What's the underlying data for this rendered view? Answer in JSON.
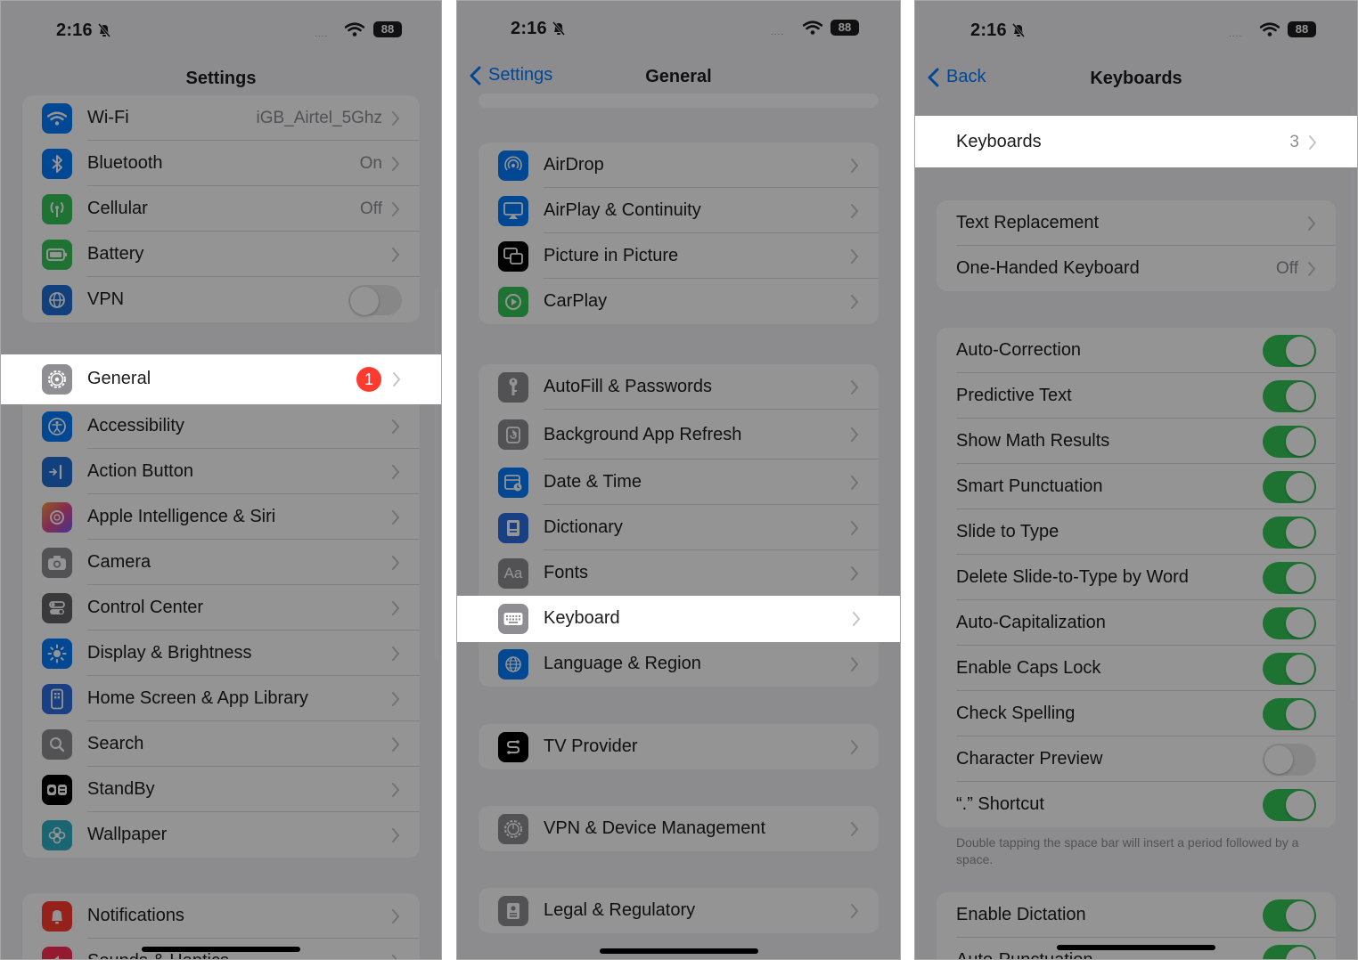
{
  "status": {
    "time": "2:16",
    "battery": "88",
    "signal": "...."
  },
  "panel1": {
    "title": "Settings",
    "group_top": [
      {
        "label": "Wi-Fi",
        "value": "iGB_Airtel_5Ghz",
        "icon": "wifi-icon",
        "color": "#007aff"
      },
      {
        "label": "Bluetooth",
        "value": "On",
        "icon": "bluetooth-icon",
        "color": "#007aff"
      },
      {
        "label": "Cellular",
        "value": "Off",
        "icon": "cellular-icon",
        "color": "#34c759"
      },
      {
        "label": "Battery",
        "value": "",
        "icon": "battery-icon",
        "color": "#34c759"
      },
      {
        "label": "VPN",
        "value": "",
        "icon": "vpn-icon",
        "color": "#1f6fd6"
      }
    ],
    "general": {
      "label": "General",
      "badge": "1",
      "icon": "gear-icon",
      "color": "#8e8e93"
    },
    "group_main": [
      {
        "label": "Accessibility",
        "icon": "accessibility-icon",
        "color": "#007aff"
      },
      {
        "label": "Action Button",
        "icon": "action-button-icon",
        "color": "#1f6fd6"
      },
      {
        "label": "Apple Intelligence & Siri",
        "icon": "siri-icon",
        "color": "#d06bd4"
      },
      {
        "label": "Camera",
        "icon": "camera-icon",
        "color": "#8e8e93"
      },
      {
        "label": "Control Center",
        "icon": "control-center-icon",
        "color": "#636366"
      },
      {
        "label": "Display & Brightness",
        "icon": "brightness-icon",
        "color": "#007aff"
      },
      {
        "label": "Home Screen & App Library",
        "icon": "home-screen-icon",
        "color": "#2c6fe0"
      },
      {
        "label": "Search",
        "icon": "search-icon",
        "color": "#8e8e93"
      },
      {
        "label": "StandBy",
        "icon": "standby-icon",
        "color": "#000000"
      },
      {
        "label": "Wallpaper",
        "icon": "wallpaper-icon",
        "color": "#30b0c7"
      }
    ],
    "group_bottom": [
      {
        "label": "Notifications",
        "icon": "notifications-icon",
        "color": "#ff3b30"
      },
      {
        "label": "Sounds & Haptics",
        "icon": "sounds-icon",
        "color": "#ff2d55"
      }
    ]
  },
  "panel2": {
    "title": "General",
    "back": "Settings",
    "group1": [
      {
        "label": "AirDrop",
        "icon": "airdrop-icon",
        "color": "#007aff"
      },
      {
        "label": "AirPlay & Continuity",
        "icon": "airplay-icon",
        "color": "#007aff"
      },
      {
        "label": "Picture in Picture",
        "icon": "pip-icon",
        "color": "#000000"
      },
      {
        "label": "CarPlay",
        "icon": "carplay-icon",
        "color": "#34c759"
      }
    ],
    "group2": [
      {
        "label": "AutoFill & Passwords",
        "icon": "key-icon",
        "color": "#8e8e93"
      },
      {
        "label": "Background App Refresh",
        "icon": "refresh-icon",
        "color": "#8e8e93"
      },
      {
        "label": "Date & Time",
        "icon": "calendar-icon",
        "color": "#007aff"
      },
      {
        "label": "Dictionary",
        "icon": "dictionary-icon",
        "color": "#2c6fe0"
      },
      {
        "label": "Fonts",
        "icon": "fonts-icon",
        "color": "#8e8e93"
      }
    ],
    "keyboard": {
      "label": "Keyboard",
      "icon": "keyboard-icon",
      "color": "#8e8e93"
    },
    "language": {
      "label": "Language & Region",
      "icon": "globe-icon",
      "color": "#007aff"
    },
    "tv": {
      "label": "TV Provider",
      "icon": "tv-provider-icon",
      "color": "#000000"
    },
    "vpn": {
      "label": "VPN & Device Management",
      "icon": "vpn-gear-icon",
      "color": "#8e8e93"
    },
    "legal": {
      "label": "Legal & Regulatory",
      "icon": "legal-icon",
      "color": "#8e8e93"
    },
    "fonts_glyph": "Aa"
  },
  "panel3": {
    "title": "Keyboards",
    "back": "Back",
    "keyboards": {
      "label": "Keyboards",
      "value": "3"
    },
    "group1": [
      {
        "label": "Text Replacement",
        "value": ""
      },
      {
        "label": "One-Handed Keyboard",
        "value": "Off"
      }
    ],
    "toggles": [
      {
        "label": "Auto-Correction",
        "on": true
      },
      {
        "label": "Predictive Text",
        "on": true
      },
      {
        "label": "Show Math Results",
        "on": true
      },
      {
        "label": "Smart Punctuation",
        "on": true
      },
      {
        "label": "Slide to Type",
        "on": true
      },
      {
        "label": "Delete Slide-to-Type by Word",
        "on": true
      },
      {
        "label": "Auto-Capitalization",
        "on": true
      },
      {
        "label": "Enable Caps Lock",
        "on": true
      },
      {
        "label": "Check Spelling",
        "on": true
      },
      {
        "label": "Character Preview",
        "on": false
      },
      {
        "label": "“.” Shortcut",
        "on": true
      }
    ],
    "footnote": "Double tapping the space bar will insert a period followed by a space.",
    "dictation": [
      {
        "label": "Enable Dictation",
        "on": true
      },
      {
        "label": "Auto-Punctuation",
        "on": true
      }
    ]
  }
}
